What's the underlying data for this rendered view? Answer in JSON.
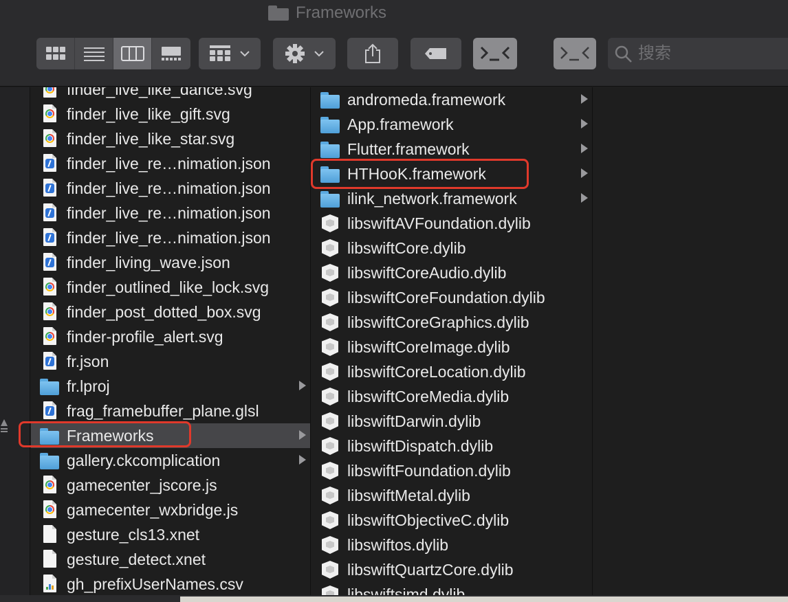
{
  "window": {
    "title": "Frameworks"
  },
  "search": {
    "placeholder": "搜索"
  },
  "column1": {
    "items": [
      {
        "label": "finder_live_like_dance.svg",
        "icon": "chrome-doc-icon",
        "folder": false
      },
      {
        "label": "finder_live_like_gift.svg",
        "icon": "chrome-doc-icon",
        "folder": false
      },
      {
        "label": "finder_live_like_star.svg",
        "icon": "chrome-doc-icon",
        "folder": false
      },
      {
        "label": "finder_live_re…nimation.json",
        "icon": "xcode-doc-icon",
        "folder": false
      },
      {
        "label": "finder_live_re…nimation.json",
        "icon": "xcode-doc-icon",
        "folder": false
      },
      {
        "label": "finder_live_re…nimation.json",
        "icon": "xcode-doc-icon",
        "folder": false
      },
      {
        "label": "finder_live_re…nimation.json",
        "icon": "xcode-doc-icon",
        "folder": false
      },
      {
        "label": "finder_living_wave.json",
        "icon": "xcode-doc-icon",
        "folder": false
      },
      {
        "label": "finder_outlined_like_lock.svg",
        "icon": "chrome-doc-icon",
        "folder": false
      },
      {
        "label": "finder_post_dotted_box.svg",
        "icon": "chrome-doc-icon",
        "folder": false
      },
      {
        "label": "finder-profile_alert.svg",
        "icon": "chrome-doc-icon",
        "folder": false
      },
      {
        "label": "fr.json",
        "icon": "xcode-doc-icon",
        "folder": false
      },
      {
        "label": "fr.lproj",
        "icon": "folder-icon",
        "folder": true
      },
      {
        "label": "frag_framebuffer_plane.glsl",
        "icon": "xcode-doc-icon",
        "folder": false
      },
      {
        "label": "Frameworks",
        "icon": "folder-icon",
        "folder": true,
        "selected": true
      },
      {
        "label": "gallery.ckcomplication",
        "icon": "folder-icon",
        "folder": true
      },
      {
        "label": "gamecenter_jscore.js",
        "icon": "chrome-doc-icon",
        "folder": false
      },
      {
        "label": "gamecenter_wxbridge.js",
        "icon": "chrome-doc-icon",
        "folder": false
      },
      {
        "label": "gesture_cls13.xnet",
        "icon": "blank-doc-icon",
        "folder": false
      },
      {
        "label": "gesture_detect.xnet",
        "icon": "blank-doc-icon",
        "folder": false
      },
      {
        "label": "gh_prefixUserNames.csv",
        "icon": "csv-doc-icon",
        "folder": false
      }
    ]
  },
  "column2": {
    "items": [
      {
        "label": "andromeda.framework",
        "icon": "folder-icon",
        "folder": true
      },
      {
        "label": "App.framework",
        "icon": "folder-icon",
        "folder": true
      },
      {
        "label": "Flutter.framework",
        "icon": "folder-icon",
        "folder": true
      },
      {
        "label": "HTHooK.framework",
        "icon": "folder-icon",
        "folder": true
      },
      {
        "label": "ilink_network.framework",
        "icon": "folder-icon",
        "folder": true
      },
      {
        "label": "libswiftAVFoundation.dylib",
        "icon": "dylib-icon",
        "folder": false
      },
      {
        "label": "libswiftCore.dylib",
        "icon": "dylib-icon",
        "folder": false
      },
      {
        "label": "libswiftCoreAudio.dylib",
        "icon": "dylib-icon",
        "folder": false
      },
      {
        "label": "libswiftCoreFoundation.dylib",
        "icon": "dylib-icon",
        "folder": false
      },
      {
        "label": "libswiftCoreGraphics.dylib",
        "icon": "dylib-icon",
        "folder": false
      },
      {
        "label": "libswiftCoreImage.dylib",
        "icon": "dylib-icon",
        "folder": false
      },
      {
        "label": "libswiftCoreLocation.dylib",
        "icon": "dylib-icon",
        "folder": false
      },
      {
        "label": "libswiftCoreMedia.dylib",
        "icon": "dylib-icon",
        "folder": false
      },
      {
        "label": "libswiftDarwin.dylib",
        "icon": "dylib-icon",
        "folder": false
      },
      {
        "label": "libswiftDispatch.dylib",
        "icon": "dylib-icon",
        "folder": false
      },
      {
        "label": "libswiftFoundation.dylib",
        "icon": "dylib-icon",
        "folder": false
      },
      {
        "label": "libswiftMetal.dylib",
        "icon": "dylib-icon",
        "folder": false
      },
      {
        "label": "libswiftObjectiveC.dylib",
        "icon": "dylib-icon",
        "folder": false
      },
      {
        "label": "libswiftos.dylib",
        "icon": "dylib-icon",
        "folder": false
      },
      {
        "label": "libswiftQuartzCore.dylib",
        "icon": "dylib-icon",
        "folder": false
      },
      {
        "label": "libswiftsimd.dylib",
        "icon": "dylib-icon",
        "folder": false
      }
    ]
  },
  "colors": {
    "highlight": "#e0392b",
    "selection": "#464649",
    "folder": "#5aa9e0"
  }
}
